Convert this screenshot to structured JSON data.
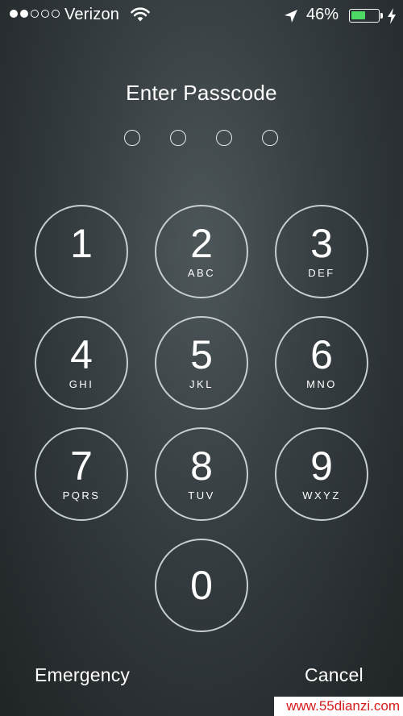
{
  "status_bar": {
    "signal_bars_filled": 2,
    "signal_bars_total": 5,
    "carrier": "Verizon",
    "wifi_icon": "wifi-icon",
    "location_icon": "location-arrow-icon",
    "battery_percent_text": "46%",
    "battery_level": 0.46,
    "battery_color": "#4cd964",
    "charging_icon": "lightning-bolt-icon"
  },
  "title": "Enter Passcode",
  "passcode": {
    "length": 4,
    "entered": 0
  },
  "keypad": {
    "keys": [
      {
        "number": "1",
        "letters": ""
      },
      {
        "number": "2",
        "letters": "ABC"
      },
      {
        "number": "3",
        "letters": "DEF"
      },
      {
        "number": "4",
        "letters": "GHI"
      },
      {
        "number": "5",
        "letters": "JKL"
      },
      {
        "number": "6",
        "letters": "MNO"
      },
      {
        "number": "7",
        "letters": "PQRS"
      },
      {
        "number": "8",
        "letters": "TUV"
      },
      {
        "number": "9",
        "letters": "WXYZ"
      },
      {
        "number": "0",
        "letters": ""
      }
    ]
  },
  "footer": {
    "emergency_label": "Emergency",
    "cancel_label": "Cancel"
  },
  "watermark": {
    "text": "www.55dianzi.com"
  }
}
